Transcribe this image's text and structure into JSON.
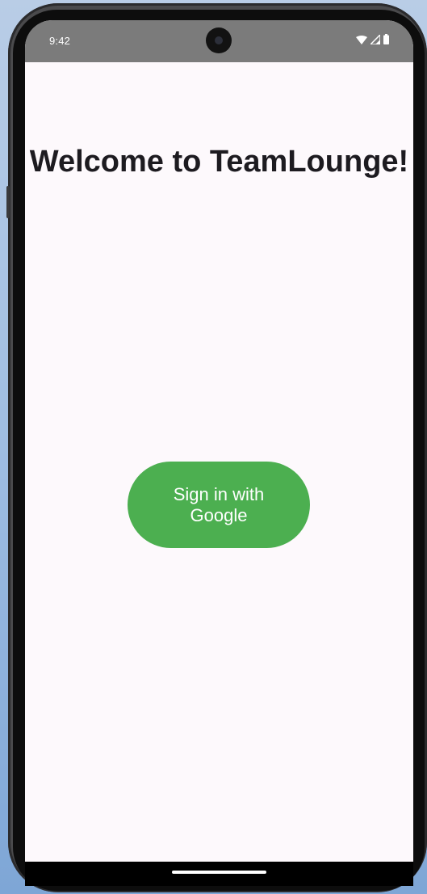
{
  "status_bar": {
    "time": "9:42",
    "icons": [
      "wifi-icon",
      "cellular-signal-icon",
      "battery-icon"
    ]
  },
  "main": {
    "title": "Welcome to TeamLounge!",
    "signin_button_label": "Sign in with Google"
  },
  "colors": {
    "background": "#fdf9fc",
    "title_text": "#1d1b20",
    "button_bg": "#4caf50",
    "button_text": "#ffffff",
    "status_bar_bg": "#7b7b7b"
  }
}
